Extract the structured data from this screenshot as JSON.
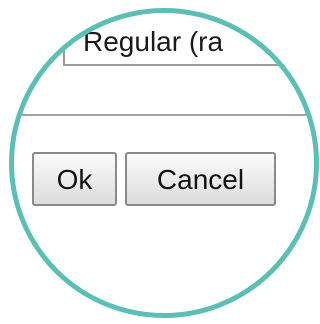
{
  "dialog": {
    "dropdown_value": "Regular (ra",
    "ok_label": "Ok",
    "cancel_label": "Cancel"
  },
  "colors": {
    "magnifier_ring": "#5bbfb5",
    "button_border": "#8a8a8a",
    "separator": "#a3a3a3"
  }
}
